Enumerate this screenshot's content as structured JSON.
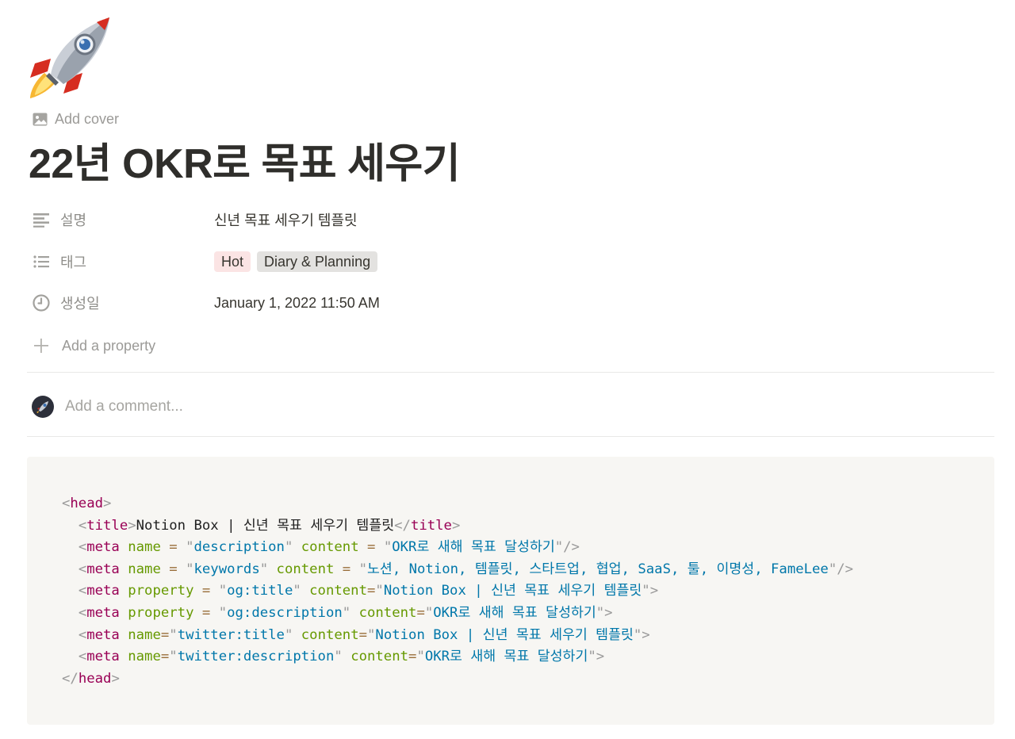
{
  "page": {
    "icon": "rocket-icon",
    "add_cover_label": "Add cover",
    "title": "22년 OKR로 목표 세우기"
  },
  "properties": [
    {
      "icon": "text-lines-icon",
      "name": "설명",
      "value": "신년 목표 세우기 템플릿"
    },
    {
      "icon": "list-icon",
      "name": "태그",
      "tags": [
        {
          "label": "Hot",
          "color": "#fbe4e4"
        },
        {
          "label": "Diary & Planning",
          "color": "#e3e2e0"
        }
      ]
    },
    {
      "icon": "clock-icon",
      "name": "생성일",
      "value": "January 1, 2022 11:50 AM"
    }
  ],
  "add_property_label": "Add a property",
  "comment": {
    "placeholder": "Add a comment...",
    "avatar_icon": "rocket-avatar-icon"
  },
  "code": {
    "lines": [
      [
        [
          "punc",
          "<"
        ],
        [
          "tag",
          "head"
        ],
        [
          "punc",
          ">"
        ]
      ],
      [
        [
          "text",
          "  "
        ],
        [
          "punc",
          "<"
        ],
        [
          "tag",
          "title"
        ],
        [
          "punc",
          ">"
        ],
        [
          "text",
          "Notion Box | 신년 목표 세우기 템플릿"
        ],
        [
          "punc",
          "</"
        ],
        [
          "tag",
          "title"
        ],
        [
          "punc",
          ">"
        ]
      ],
      [
        [
          "text",
          "  "
        ],
        [
          "punc",
          "<"
        ],
        [
          "tag",
          "meta"
        ],
        [
          "text",
          " "
        ],
        [
          "attr",
          "name"
        ],
        [
          "text",
          " "
        ],
        [
          "eq",
          "="
        ],
        [
          "text",
          " "
        ],
        [
          "punc",
          "\""
        ],
        [
          "str",
          "description"
        ],
        [
          "punc",
          "\""
        ],
        [
          "text",
          " "
        ],
        [
          "attr",
          "content"
        ],
        [
          "text",
          " "
        ],
        [
          "eq",
          "="
        ],
        [
          "text",
          " "
        ],
        [
          "punc",
          "\""
        ],
        [
          "str",
          "OKR로 새해 목표 달성하기"
        ],
        [
          "punc",
          "\""
        ],
        [
          "punc",
          "/>"
        ]
      ],
      [
        [
          "text",
          "  "
        ],
        [
          "punc",
          "<"
        ],
        [
          "tag",
          "meta"
        ],
        [
          "text",
          " "
        ],
        [
          "attr",
          "name"
        ],
        [
          "text",
          " "
        ],
        [
          "eq",
          "="
        ],
        [
          "text",
          " "
        ],
        [
          "punc",
          "\""
        ],
        [
          "str",
          "keywords"
        ],
        [
          "punc",
          "\""
        ],
        [
          "text",
          " "
        ],
        [
          "attr",
          "content"
        ],
        [
          "text",
          " "
        ],
        [
          "eq",
          "="
        ],
        [
          "text",
          " "
        ],
        [
          "punc",
          "\""
        ],
        [
          "str",
          "노션, Notion, 템플릿, 스타트업, 협업, SaaS, 툴, 이명성, FameLee"
        ],
        [
          "punc",
          "\""
        ],
        [
          "punc",
          "/>"
        ]
      ],
      [
        [
          "text",
          "  "
        ],
        [
          "punc",
          "<"
        ],
        [
          "tag",
          "meta"
        ],
        [
          "text",
          " "
        ],
        [
          "attr",
          "property"
        ],
        [
          "text",
          " "
        ],
        [
          "eq",
          "="
        ],
        [
          "text",
          " "
        ],
        [
          "punc",
          "\""
        ],
        [
          "str",
          "og:title"
        ],
        [
          "punc",
          "\""
        ],
        [
          "text",
          " "
        ],
        [
          "attr",
          "content"
        ],
        [
          "eq",
          "="
        ],
        [
          "punc",
          "\""
        ],
        [
          "str",
          "Notion Box | 신년 목표 세우기 템플릿"
        ],
        [
          "punc",
          "\""
        ],
        [
          "punc",
          ">"
        ]
      ],
      [
        [
          "text",
          "  "
        ],
        [
          "punc",
          "<"
        ],
        [
          "tag",
          "meta"
        ],
        [
          "text",
          " "
        ],
        [
          "attr",
          "property"
        ],
        [
          "text",
          " "
        ],
        [
          "eq",
          "="
        ],
        [
          "text",
          " "
        ],
        [
          "punc",
          "\""
        ],
        [
          "str",
          "og:description"
        ],
        [
          "punc",
          "\""
        ],
        [
          "text",
          " "
        ],
        [
          "attr",
          "content"
        ],
        [
          "eq",
          "="
        ],
        [
          "punc",
          "\""
        ],
        [
          "str",
          "OKR로 새해 목표 달성하기"
        ],
        [
          "punc",
          "\""
        ],
        [
          "punc",
          ">"
        ]
      ],
      [
        [
          "text",
          "  "
        ],
        [
          "punc",
          "<"
        ],
        [
          "tag",
          "meta"
        ],
        [
          "text",
          " "
        ],
        [
          "attr",
          "name"
        ],
        [
          "eq",
          "="
        ],
        [
          "punc",
          "\""
        ],
        [
          "str",
          "twitter:title"
        ],
        [
          "punc",
          "\""
        ],
        [
          "text",
          " "
        ],
        [
          "attr",
          "content"
        ],
        [
          "eq",
          "="
        ],
        [
          "punc",
          "\""
        ],
        [
          "str",
          "Notion Box | 신년 목표 세우기 템플릿"
        ],
        [
          "punc",
          "\""
        ],
        [
          "punc",
          ">"
        ]
      ],
      [
        [
          "text",
          "  "
        ],
        [
          "punc",
          "<"
        ],
        [
          "tag",
          "meta"
        ],
        [
          "text",
          " "
        ],
        [
          "attr",
          "name"
        ],
        [
          "eq",
          "="
        ],
        [
          "punc",
          "\""
        ],
        [
          "str",
          "twitter:description"
        ],
        [
          "punc",
          "\""
        ],
        [
          "text",
          " "
        ],
        [
          "attr",
          "content"
        ],
        [
          "eq",
          "="
        ],
        [
          "punc",
          "\""
        ],
        [
          "str",
          "OKR로 새해 목표 달성하기"
        ],
        [
          "punc",
          "\""
        ],
        [
          "punc",
          ">"
        ]
      ],
      [
        [
          "punc",
          "</"
        ],
        [
          "tag",
          "head"
        ],
        [
          "punc",
          ">"
        ]
      ]
    ]
  }
}
